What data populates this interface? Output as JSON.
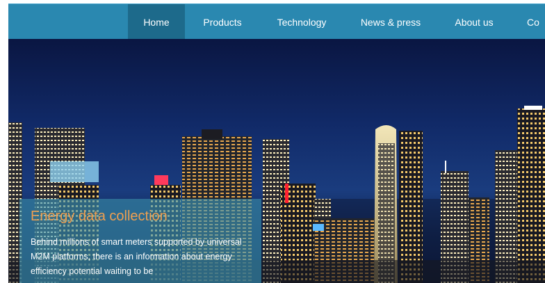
{
  "nav": {
    "items": [
      {
        "label": "Home",
        "active": true
      },
      {
        "label": "Products",
        "active": false
      },
      {
        "label": "Technology",
        "active": false
      },
      {
        "label": "News & press",
        "active": false
      },
      {
        "label": "About us",
        "active": false
      },
      {
        "label": "Co",
        "active": false
      }
    ]
  },
  "hero": {
    "title": "Energy data collection",
    "text": "Behind millions of smart meters supported by universal M2M platforms, there is an information about energy efficiency potential waiting to be"
  },
  "colors": {
    "nav_bg": "#2a88b0",
    "nav_active_bg": "#1d6a8b",
    "caption_title": "#f0a050"
  },
  "icons": {
    "hero_image": "city-skyline-night"
  }
}
